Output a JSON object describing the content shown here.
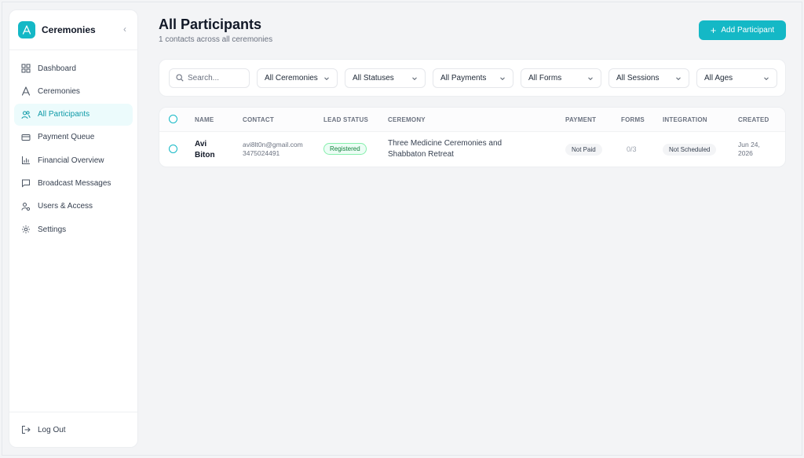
{
  "sidebar": {
    "brand": "Ceremonies",
    "items": [
      {
        "label": "Dashboard",
        "icon": "dashboard-icon"
      },
      {
        "label": "Ceremonies",
        "icon": "ceremonies-icon"
      },
      {
        "label": "All Participants",
        "icon": "users-icon",
        "active": true
      },
      {
        "label": "Payment Queue",
        "icon": "credit-card-icon"
      },
      {
        "label": "Financial Overview",
        "icon": "bar-chart-icon"
      },
      {
        "label": "Broadcast Messages",
        "icon": "message-icon"
      },
      {
        "label": "Users & Access",
        "icon": "user-key-icon"
      },
      {
        "label": "Settings",
        "icon": "gear-icon"
      }
    ],
    "logout": "Log Out"
  },
  "header": {
    "title": "All Participants",
    "subtitle": "1 contacts across all ceremonies",
    "add_button": "Add Participant"
  },
  "filters": {
    "search_placeholder": "Search...",
    "selects": [
      "All Ceremonies",
      "All Statuses",
      "All Payments",
      "All Forms",
      "All Sessions",
      "All Ages"
    ]
  },
  "table": {
    "columns": [
      "NAME",
      "CONTACT",
      "LEAD STATUS",
      "CEREMONY",
      "PAYMENT",
      "FORMS",
      "INTEGRATION",
      "CREATED"
    ],
    "rows": [
      {
        "name": "Avi Biton",
        "email": "avi8lt0n@gmail.com",
        "phone": "3475024491",
        "lead_status": "Registered",
        "ceremony": "Three Medicine Ceremonies and Shabbaton Retreat",
        "payment": "Not Paid",
        "forms": "0/3",
        "integration": "Not Scheduled",
        "created": "Jun 24, 2026"
      }
    ]
  },
  "colors": {
    "accent": "#14b8c6",
    "active_bg": "#ecfbfc",
    "registered_green": "#15803d"
  }
}
